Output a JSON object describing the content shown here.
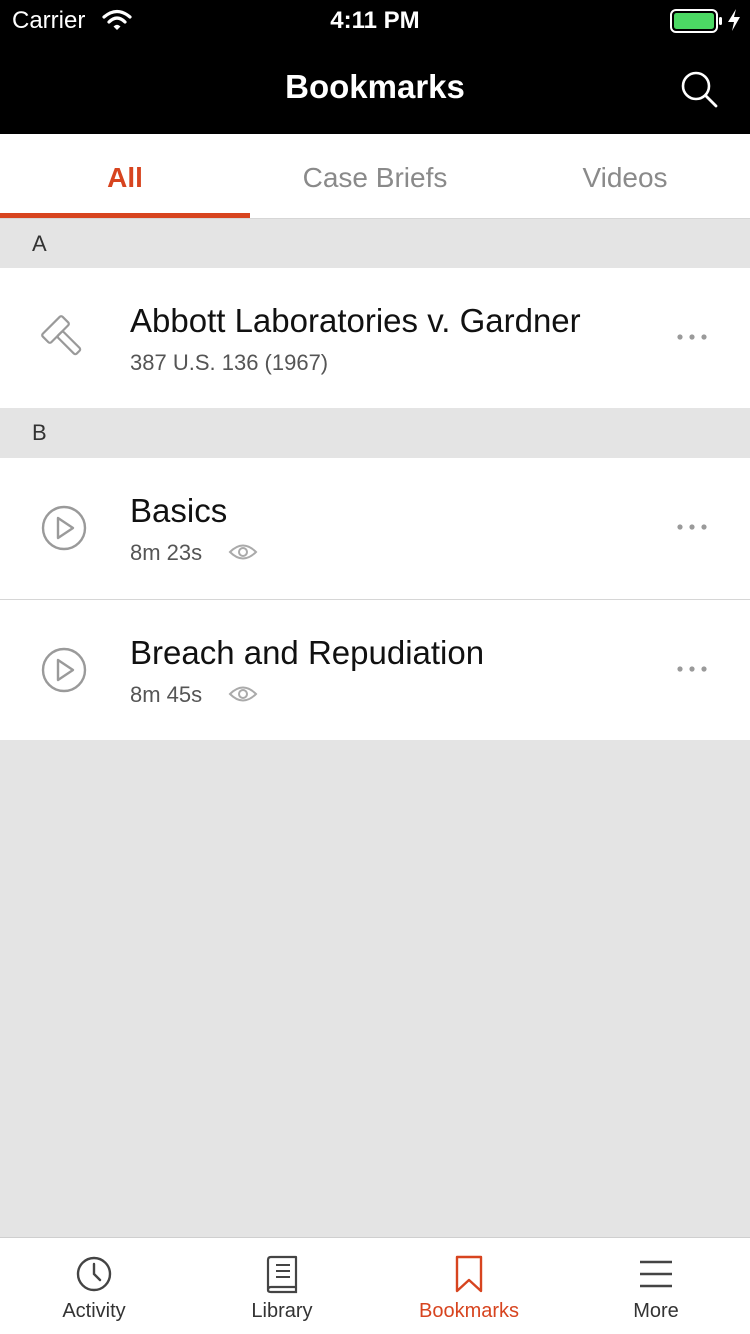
{
  "status_bar": {
    "carrier": "Carrier",
    "time": "4:11 PM"
  },
  "nav": {
    "title": "Bookmarks"
  },
  "tabs": [
    {
      "label": "All",
      "active": true
    },
    {
      "label": "Case Briefs",
      "active": false
    },
    {
      "label": "Videos",
      "active": false
    }
  ],
  "sections": [
    {
      "letter": "A",
      "items": [
        {
          "icon": "gavel-icon",
          "title": "Abbott Laboratories v. Gardner",
          "subtitle": "387 U.S. 136 (1967)"
        }
      ]
    },
    {
      "letter": "B",
      "items": [
        {
          "icon": "play-circle-icon",
          "title": "Basics",
          "subtitle": "8m 23s",
          "viewed_icon": "eye-icon"
        },
        {
          "icon": "play-circle-icon",
          "title": "Breach and Repudiation",
          "subtitle": "8m 45s",
          "viewed_icon": "eye-icon"
        }
      ]
    }
  ],
  "tabbar": [
    {
      "label": "Activity",
      "icon": "clock-icon",
      "active": false
    },
    {
      "label": "Library",
      "icon": "book-icon",
      "active": false
    },
    {
      "label": "Bookmarks",
      "icon": "bookmark-icon",
      "active": true
    },
    {
      "label": "More",
      "icon": "menu-icon",
      "active": false
    }
  ],
  "colors": {
    "accent": "#d7441f",
    "nav_bg": "#000000",
    "battery": "#4cd964",
    "page_bg": "#e4e4e4"
  }
}
